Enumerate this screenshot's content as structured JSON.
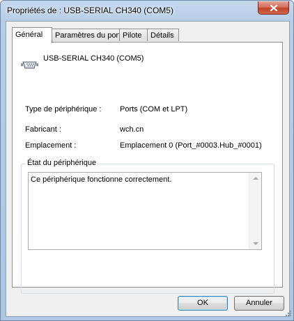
{
  "window": {
    "title": "Propriétés de : USB-SERIAL CH340 (COM5)",
    "close_glyph": "✕"
  },
  "tabs": [
    {
      "label": "Général",
      "active": true
    },
    {
      "label": "Paramètres du port",
      "active": false
    },
    {
      "label": "Pilote",
      "active": false
    },
    {
      "label": "Détails",
      "active": false
    }
  ],
  "device": {
    "name": "USB-SERIAL CH340 (COM5)",
    "icon": "serial-port-icon"
  },
  "properties": {
    "type_label": "Type de périphérique :",
    "type_value": "Ports (COM et LPT)",
    "manufacturer_label": "Fabricant :",
    "manufacturer_value": "wch.cn",
    "location_label": "Emplacement :",
    "location_value": "Emplacement 0 (Port_#0003.Hub_#0001)"
  },
  "status": {
    "group_label": "État du périphérique",
    "text": "Ce périphérique fonctionne correctement."
  },
  "buttons": {
    "ok": "OK",
    "cancel": "Annuler"
  },
  "colors": {
    "accent": "#3c7fb1",
    "close": "#c0412a"
  }
}
